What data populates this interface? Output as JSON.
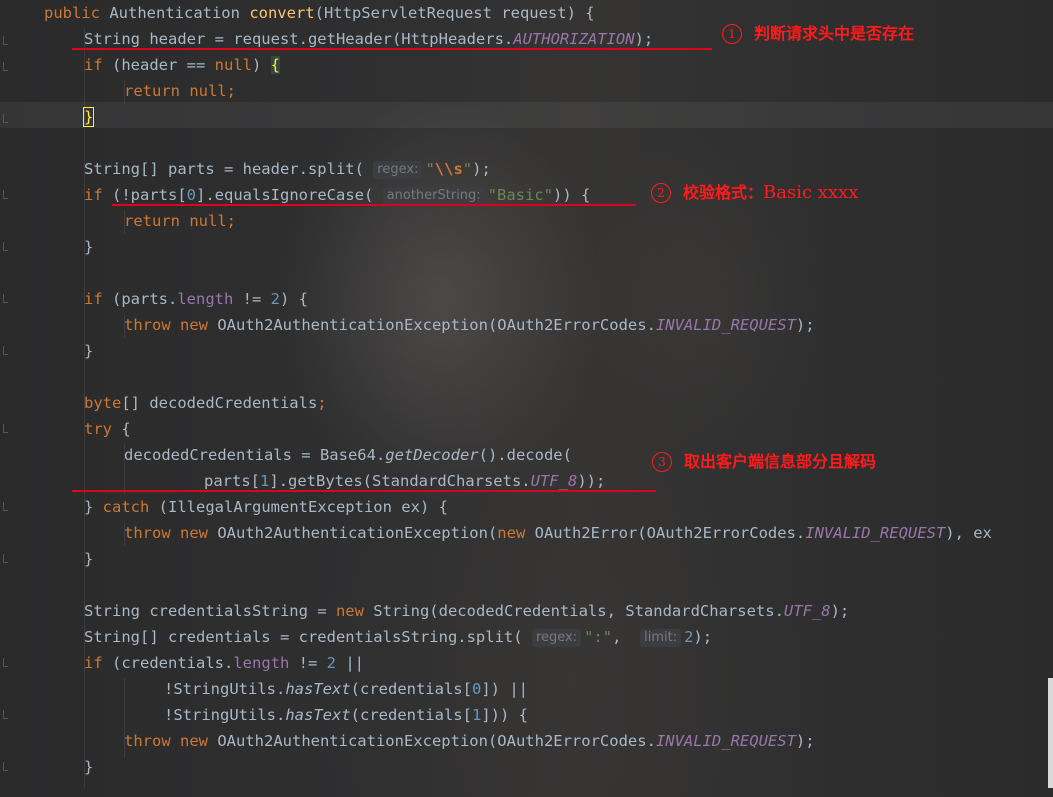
{
  "code": {
    "method_signature": {
      "kw_public": "public ",
      "name_pre": "Authentication ",
      "fn": "convert",
      "rest": "(HttpServletRequest request) {"
    },
    "l1": {
      "a": "String header = request.getHeader(HttpHeaders.",
      "const": "AUTHORIZATION",
      "b": ");"
    },
    "l2": {
      "kw": "if",
      "a": " (header == ",
      "kw2": "null",
      "b": ") ",
      "brace": "{"
    },
    "l3": {
      "kw": "return ",
      "kw2": "null",
      "b": ";"
    },
    "l4": {
      "brace": "}"
    },
    "l5": {
      "a": "String[] parts = header.split( ",
      "hint": "regex:",
      "s1": "\"",
      "esc": "\\\\s",
      "s2": "\"",
      "b": ");"
    },
    "l6": {
      "kw": "if",
      "a": " (!parts[",
      "num": "0",
      "b": "].equalsIgnoreCase( ",
      "hint": "anotherString:",
      "str": "\"Basic\"",
      "c": ")) {"
    },
    "l7": {
      "kw": "return ",
      "kw2": "null",
      "b": ";"
    },
    "l8": {
      "a": "}"
    },
    "l9": {
      "kw": "if",
      "a": " (parts.",
      "field": "length",
      "b": " != ",
      "num": "2",
      "c": ") {"
    },
    "l10": {
      "kw": "throw new ",
      "a": "OAuth2AuthenticationException(OAuth2ErrorCodes.",
      "const": "INVALID_REQUEST",
      "b": ");"
    },
    "l11": {
      "a": "}"
    },
    "l12": {
      "kw": "byte",
      "a": "[] decodedCredentials",
      "kw2": ";"
    },
    "l13": {
      "kw": "try",
      "a": " {"
    },
    "l14": {
      "a": "decodedCredentials = Base64.",
      "st": "getDecoder",
      "b": "().decode("
    },
    "l15": {
      "a": "parts[",
      "num": "1",
      "b": "].getBytes(StandardCharsets.",
      "const": "UTF_8",
      "c": "));"
    },
    "l16": {
      "a": "} ",
      "kw": "catch",
      "b": " (IllegalArgumentException ex) {"
    },
    "l17": {
      "kw": "throw new ",
      "a": "OAuth2AuthenticationException(",
      "kw2": "new ",
      "b": "OAuth2Error(OAuth2ErrorCodes.",
      "const": "INVALID_REQUEST",
      "c": "), ex"
    },
    "l18": {
      "a": "}"
    },
    "l19": {
      "a": "String credentialsString = ",
      "kw": "new ",
      "b": "String(decodedCredentials, StandardCharsets.",
      "const": "UTF_8",
      "c": ");"
    },
    "l20": {
      "a": "String[] credentials = credentialsString.split( ",
      "hint": "regex:",
      "str": "\":\"",
      "b": ",  ",
      "hint2": "limit:",
      "num": "2",
      "c": ");"
    },
    "l21": {
      "kw": "if",
      "a": " (credentials.",
      "field": "length",
      "b": " != ",
      "num": "2",
      "c": " ||"
    },
    "l22": {
      "a": "!StringUtils.",
      "st": "hasText",
      "b": "(credentials[",
      "num": "0",
      "c": "]) ||"
    },
    "l23": {
      "a": "!StringUtils.",
      "st": "hasText",
      "b": "(credentials[",
      "num": "1",
      "c": "])) {"
    },
    "l24": {
      "kw": "throw new ",
      "a": "OAuth2AuthenticationException(OAuth2ErrorCodes.",
      "const": "INVALID_REQUEST",
      "b": ");"
    },
    "l25": {
      "a": "}"
    }
  },
  "annotations": {
    "a1": {
      "num": "1",
      "text": "判断请求头中是否存在"
    },
    "a2": {
      "num": "2",
      "text": "校验格式：",
      "text2": "Basic xxxx"
    },
    "a3": {
      "num": "3",
      "text": "取出客户端信息部分且解码"
    }
  },
  "colors": {
    "keyword": "#cc7832",
    "method": "#ffc66d",
    "number": "#6897bb",
    "string": "#6a8759",
    "constant": "#9876aa",
    "annotation": "#ff1b1b"
  }
}
